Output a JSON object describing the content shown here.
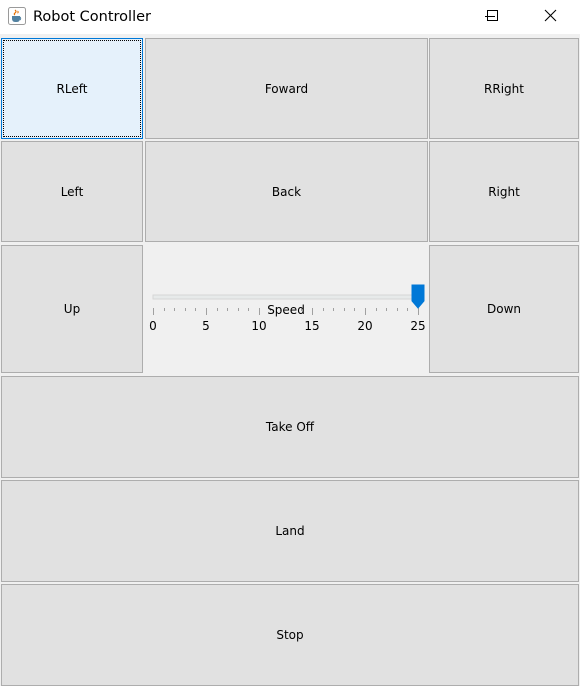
{
  "window": {
    "title": "Robot Controller",
    "icon": "java-cup-icon",
    "controls": [
      "minimize-icon",
      "maximize-icon",
      "close-icon"
    ]
  },
  "buttons": {
    "rleft": "RLeft",
    "forward": "Foward",
    "rright": "RRight",
    "left": "Left",
    "back": "Back",
    "right": "Right",
    "up": "Up",
    "down": "Down",
    "takeoff": "Take Off",
    "land": "Land",
    "stop": "Stop"
  },
  "speed": {
    "label": "Speed",
    "min": 0,
    "max": 25,
    "value": 25,
    "major_ticks": [
      "0",
      "5",
      "10",
      "15",
      "20",
      "25"
    ],
    "minor_step": 1
  },
  "colors": {
    "accent": "#0078d7",
    "button_bg": "#e1e1e1",
    "focused_bg": "#e5f1fb"
  }
}
